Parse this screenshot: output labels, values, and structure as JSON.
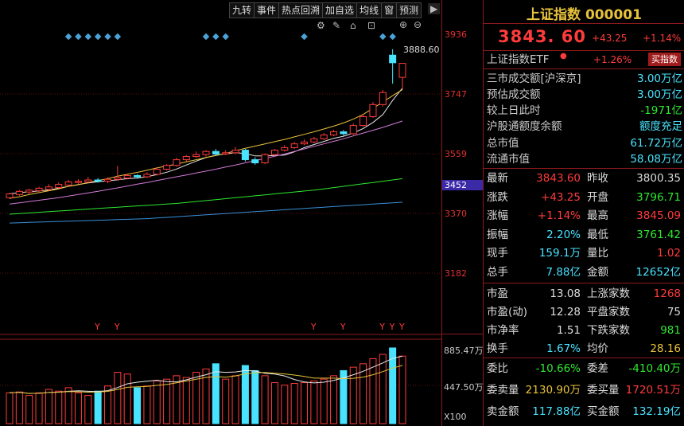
{
  "toolbar": {
    "buttons": [
      "九转",
      "事件",
      "热点回溯",
      "加自选",
      "均线",
      "窗",
      "预测"
    ],
    "icons": [
      "settings-icon",
      "pen-icon",
      "lock-icon",
      "expand-icon",
      "zoom-in-icon",
      "zoom-out-icon",
      "collapse-arrow-icon"
    ]
  },
  "price_axis": {
    "labels": [
      "3936",
      "3747",
      "3559",
      "3452",
      "3370",
      "3182"
    ],
    "current": "3452"
  },
  "volume_axis": {
    "labels": [
      "885.47万",
      "447.50万",
      "X100"
    ]
  },
  "chart": {
    "high_label": "3888.60",
    "event_markers": "Y",
    "colors": {
      "up": "#ff3b3b",
      "down": "#49e3ff",
      "ma5": "#e8e8e8",
      "ma10": "#e8c23a",
      "ma20": "#d27ad6",
      "ma60": "#2ee82e",
      "ma120": "#3a8fd8",
      "marker": "#49a3d8"
    }
  },
  "header": {
    "title": "上证指数 000001",
    "price": "3843. 60",
    "change": "+43.25",
    "change_pct": "+1.14%"
  },
  "etf": {
    "label": "上证指数ETF",
    "value": "+1.26%",
    "button": "买指数"
  },
  "stats": [
    {
      "label": "三市成交额[沪深京]",
      "value": "3.00万亿"
    },
    {
      "label": "预估成交额",
      "value": "3.00万亿"
    },
    {
      "label": "较上日此时",
      "value": "-1971亿"
    },
    {
      "label": "沪股通额度余额",
      "value": "额度充足"
    },
    {
      "label": "总市值",
      "value": "61.72万亿"
    },
    {
      "label": "流通市值",
      "value": "58.08万亿"
    }
  ],
  "quote_grid": [
    [
      "最新",
      "3843.60",
      "昨收",
      "3800.35"
    ],
    [
      "涨跌",
      "+43.25",
      "开盘",
      "3796.71"
    ],
    [
      "涨幅",
      "+1.14%",
      "最高",
      "3845.09"
    ],
    [
      "振幅",
      "2.20%",
      "最低",
      "3761.42"
    ],
    [
      "现手",
      "159.1万",
      "量比",
      "1.02"
    ],
    [
      "总手",
      "7.88亿",
      "金额",
      "12652亿"
    ]
  ],
  "market_grid": [
    [
      "市盈",
      "13.08",
      "上涨家数",
      "1268"
    ],
    [
      "市盈(动)",
      "12.28",
      "平盘家数",
      "75"
    ],
    [
      "市净率",
      "1.51",
      "下跌家数",
      "981"
    ],
    [
      "换手",
      "1.67%",
      "均价",
      "28.16"
    ]
  ],
  "order_grid": [
    [
      "委比",
      "-10.66%",
      "委差",
      "-410.40万"
    ],
    [
      "委卖量",
      "2130.90万",
      "委买量",
      "1720.51万"
    ],
    [
      "卖金额",
      "117.88亿",
      "买金额",
      "132.19亿"
    ]
  ],
  "chart_data": {
    "type": "candlestick",
    "ma_series": [
      {
        "values": [
          3418,
          3423,
          3430,
          3436,
          3442,
          3448,
          3456,
          3461,
          3468,
          3474,
          3480,
          3488,
          3494,
          3500,
          3507,
          3514,
          3520,
          3526,
          3533,
          3540,
          3547,
          3553,
          3560,
          3568,
          3576,
          3583,
          3590,
          3597,
          3604,
          3612,
          3620,
          3628,
          3637,
          3646,
          3656,
          3668,
          3683,
          3702,
          3722,
          3742,
          3761
        ]
      },
      {
        "values": [
          3400,
          3404,
          3408,
          3412,
          3416,
          3420,
          3425,
          3430,
          3435,
          3440,
          3446,
          3451,
          3457,
          3463,
          3468,
          3474,
          3480,
          3486,
          3492,
          3498,
          3504,
          3510,
          3517,
          3523,
          3530,
          3537,
          3544,
          3551,
          3558,
          3566,
          3574,
          3582,
          3590,
          3598,
          3606,
          3615,
          3624,
          3633,
          3642,
          3652,
          3662
        ]
      },
      {
        "values": [
          3368,
          3370,
          3372,
          3374,
          3376,
          3378,
          3380,
          3382,
          3384,
          3386,
          3388,
          3390,
          3392,
          3394,
          3396,
          3398,
          3400,
          3402,
          3405,
          3408,
          3411,
          3414,
          3417,
          3420,
          3423,
          3426,
          3429,
          3432,
          3435,
          3438,
          3441,
          3444,
          3448,
          3452,
          3456,
          3460,
          3464,
          3468,
          3472,
          3476,
          3480
        ]
      },
      {
        "values": [
          3340,
          3341,
          3342,
          3343,
          3344,
          3345,
          3346,
          3347,
          3348,
          3349,
          3350,
          3351,
          3352,
          3353,
          3354,
          3356,
          3358,
          3360,
          3362,
          3364,
          3366,
          3368,
          3370,
          3372,
          3374,
          3376,
          3378,
          3380,
          3382,
          3384,
          3386,
          3388,
          3390,
          3392,
          3394,
          3396,
          3398,
          3400,
          3402,
          3404,
          3406
        ]
      }
    ],
    "candles": [
      {
        "o": 3420,
        "c": 3432,
        "h": 3436,
        "l": 3416,
        "vol": 360
      },
      {
        "o": 3430,
        "c": 3440,
        "h": 3444,
        "l": 3426,
        "vol": 370
      },
      {
        "o": 3438,
        "c": 3444,
        "h": 3448,
        "l": 3432,
        "vol": 330
      },
      {
        "o": 3442,
        "c": 3450,
        "h": 3454,
        "l": 3436,
        "vol": 360
      },
      {
        "o": 3446,
        "c": 3454,
        "h": 3462,
        "l": 3442,
        "vol": 400
      },
      {
        "o": 3452,
        "c": 3462,
        "h": 3468,
        "l": 3448,
        "vol": 380
      },
      {
        "o": 3460,
        "c": 3470,
        "h": 3476,
        "l": 3456,
        "vol": 420
      },
      {
        "o": 3468,
        "c": 3472,
        "h": 3478,
        "l": 3462,
        "vol": 360
      },
      {
        "o": 3470,
        "c": 3476,
        "h": 3486,
        "l": 3466,
        "vol": 330
      },
      {
        "o": 3476,
        "c": 3472,
        "h": 3482,
        "l": 3468,
        "vol": 380
      },
      {
        "o": 3472,
        "c": 3478,
        "h": 3484,
        "l": 3466,
        "vol": 440
      },
      {
        "o": 3478,
        "c": 3484,
        "h": 3520,
        "l": 3474,
        "vol": 600
      },
      {
        "o": 3482,
        "c": 3490,
        "h": 3496,
        "l": 3478,
        "vol": 580
      },
      {
        "o": 3490,
        "c": 3486,
        "h": 3494,
        "l": 3480,
        "vol": 420
      },
      {
        "o": 3486,
        "c": 3494,
        "h": 3500,
        "l": 3482,
        "vol": 440
      },
      {
        "o": 3494,
        "c": 3510,
        "h": 3516,
        "l": 3490,
        "vol": 500
      },
      {
        "o": 3510,
        "c": 3522,
        "h": 3526,
        "l": 3506,
        "vol": 520
      },
      {
        "o": 3522,
        "c": 3540,
        "h": 3546,
        "l": 3518,
        "vol": 560
      },
      {
        "o": 3540,
        "c": 3550,
        "h": 3554,
        "l": 3534,
        "vol": 540
      },
      {
        "o": 3550,
        "c": 3556,
        "h": 3566,
        "l": 3546,
        "vol": 600
      },
      {
        "o": 3556,
        "c": 3566,
        "h": 3570,
        "l": 3550,
        "vol": 640
      },
      {
        "o": 3566,
        "c": 3558,
        "h": 3574,
        "l": 3552,
        "vol": 700
      },
      {
        "o": 3558,
        "c": 3562,
        "h": 3570,
        "l": 3554,
        "vol": 520
      },
      {
        "o": 3562,
        "c": 3570,
        "h": 3580,
        "l": 3558,
        "vol": 560
      },
      {
        "o": 3570,
        "c": 3540,
        "h": 3574,
        "l": 3534,
        "vol": 680
      },
      {
        "o": 3540,
        "c": 3530,
        "h": 3548,
        "l": 3524,
        "vol": 620
      },
      {
        "o": 3530,
        "c": 3556,
        "h": 3560,
        "l": 3526,
        "vol": 560
      },
      {
        "o": 3556,
        "c": 3570,
        "h": 3574,
        "l": 3552,
        "vol": 480
      },
      {
        "o": 3570,
        "c": 3578,
        "h": 3586,
        "l": 3566,
        "vol": 450
      },
      {
        "o": 3578,
        "c": 3590,
        "h": 3596,
        "l": 3574,
        "vol": 470
      },
      {
        "o": 3590,
        "c": 3596,
        "h": 3604,
        "l": 3586,
        "vol": 480
      },
      {
        "o": 3596,
        "c": 3606,
        "h": 3612,
        "l": 3592,
        "vol": 500
      },
      {
        "o": 3606,
        "c": 3618,
        "h": 3624,
        "l": 3602,
        "vol": 520
      },
      {
        "o": 3618,
        "c": 3628,
        "h": 3634,
        "l": 3614,
        "vol": 560
      },
      {
        "o": 3628,
        "c": 3622,
        "h": 3634,
        "l": 3616,
        "vol": 620
      },
      {
        "o": 3622,
        "c": 3648,
        "h": 3654,
        "l": 3618,
        "vol": 660
      },
      {
        "o": 3648,
        "c": 3676,
        "h": 3684,
        "l": 3644,
        "vol": 700
      },
      {
        "o": 3676,
        "c": 3714,
        "h": 3722,
        "l": 3672,
        "vol": 760
      },
      {
        "o": 3714,
        "c": 3752,
        "h": 3760,
        "l": 3708,
        "vol": 810
      },
      {
        "o": 3870,
        "c": 3846,
        "h": 3889,
        "l": 3780,
        "vol": 885
      },
      {
        "o": 3800,
        "c": 3844,
        "h": 3845,
        "l": 3761,
        "vol": 790
      }
    ]
  }
}
